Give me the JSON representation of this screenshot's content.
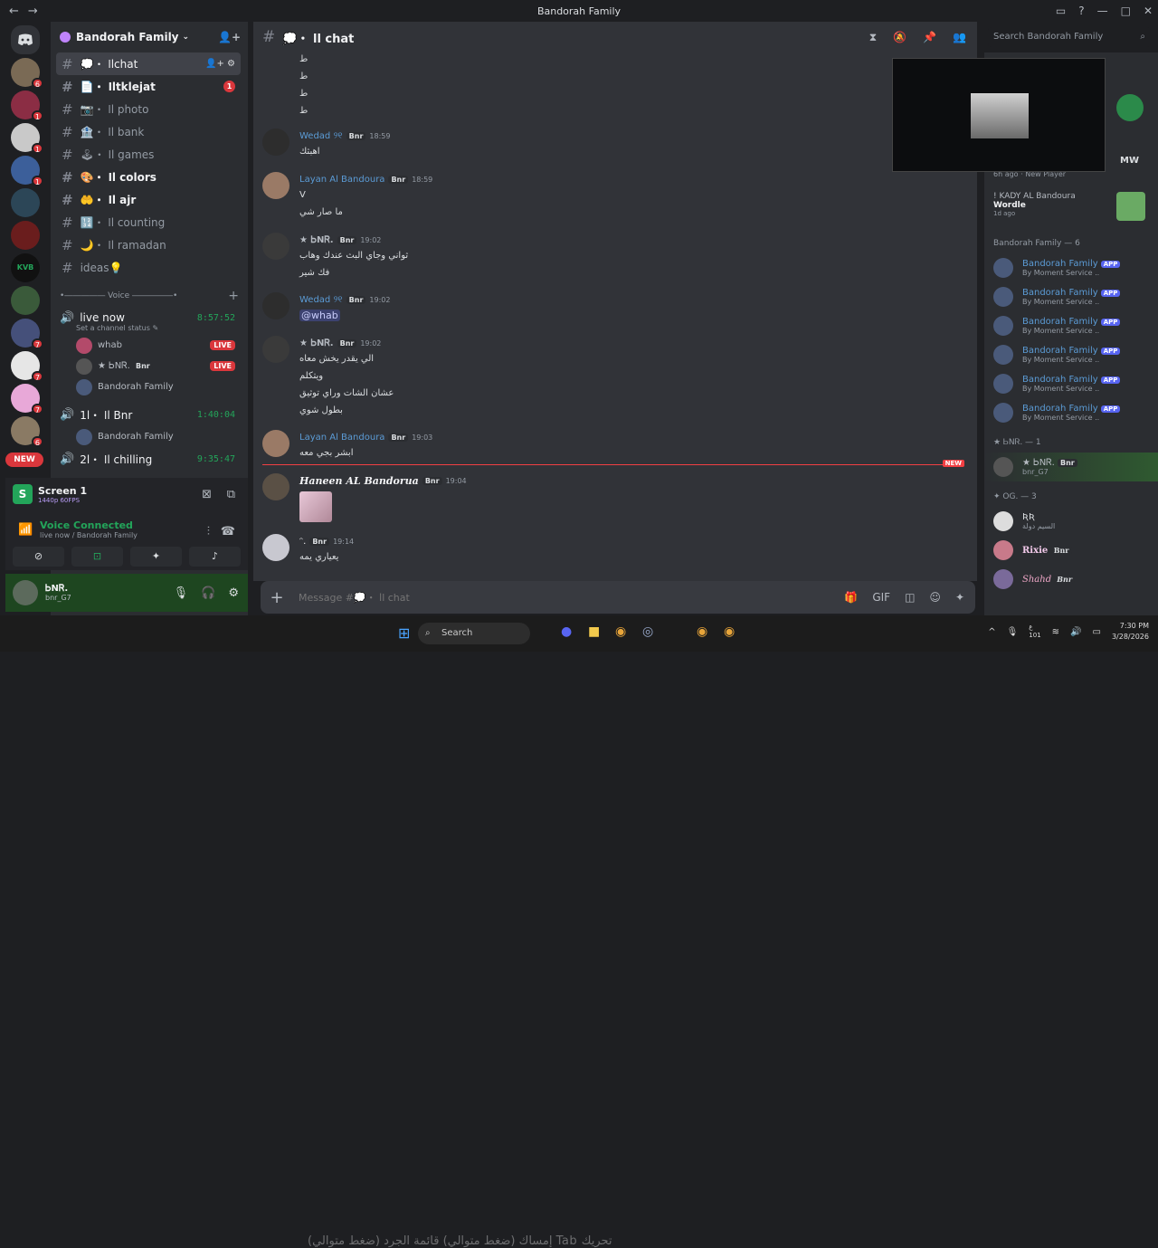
{
  "window": {
    "title": "Bandorah Family"
  },
  "guilds": {
    "badges": [
      "6",
      "1",
      "",
      "1",
      "",
      "1",
      "",
      "",
      "",
      "",
      "",
      "7",
      "",
      "7",
      "",
      "6"
    ],
    "new_label": "NEW"
  },
  "server": {
    "name": "Bandorah Family"
  },
  "channels": [
    {
      "name": "💭・ اlchat",
      "state": "active"
    },
    {
      "name": "📄・ اltklejat",
      "state": "unread",
      "badge": "1"
    },
    {
      "name": "📷・ اl photo",
      "state": "normal"
    },
    {
      "name": "🏦・ اl bank",
      "state": "normal"
    },
    {
      "name": "🕹・ اl games",
      "state": "normal"
    },
    {
      "name": "🎨・ اl colors",
      "state": "unread"
    },
    {
      "name": "🤲・ اl ajr",
      "state": "unread"
    },
    {
      "name": "🔢・ اl counting",
      "state": "normal"
    },
    {
      "name": "🌙・ اl ramadan",
      "state": "normal"
    },
    {
      "name": "ideas💡",
      "state": "normal"
    }
  ],
  "voice_category": {
    "label": "•――――― Voice ―――――•"
  },
  "voice": {
    "live_now": {
      "name": "live now",
      "timer": "8:57:52",
      "status": "Set a channel status ✎",
      "users": [
        {
          "name": "whab",
          "live": "LIVE"
        },
        {
          "name": "★ ᏏNᏒ.",
          "tag": "Bnr",
          "live": "LIVE"
        },
        {
          "name": "Bandorah Family"
        }
      ]
    },
    "bnr": {
      "name": "1l・ اl Bnr",
      "timer": "1:40:04",
      "users": [
        {
          "name": "Bandorah Family"
        }
      ]
    },
    "chilling": {
      "name": "2l・ اl chilling",
      "timer": "9:35:47"
    }
  },
  "screen": {
    "title": "Screen 1",
    "quality": "1440p 60FPS"
  },
  "voice_connected": {
    "title": "Voice Connected",
    "sub": "live now / Bandorah Family"
  },
  "user": {
    "name": "ᏏNᏒ.",
    "tag": "bnr_G7"
  },
  "chat": {
    "channel": "💭・ اl chat",
    "search_placeholder": "Search Bandorah Family",
    "composer_placeholder": "Message #💭・ اl chat"
  },
  "messages": [
    {
      "name": "",
      "lines": [
        "ط",
        "ط",
        "ط",
        "ط"
      ]
    },
    {
      "name": "Wedad ୨୧",
      "tag": "Bnr",
      "time": "18:59",
      "lines": [
        "اهبثك"
      ]
    },
    {
      "name": "Layan Al Bandoura",
      "tag": "Bnr",
      "time": "18:59",
      "lines": [
        "V",
        "ما صار شي"
      ]
    },
    {
      "name": "★ ᏏNᏒ.",
      "tag": "Bnr",
      "time": "19:02",
      "lines": [
        "ثواني وجاي البث عندك وهاب",
        "فك شير"
      ]
    },
    {
      "name": "Wedad ୨୧",
      "tag": "Bnr",
      "time": "19:02",
      "lines": [
        "@whab"
      ]
    },
    {
      "name": "★ ᏏNᏒ.",
      "tag": "Bnr",
      "time": "19:02",
      "lines": [
        "الي يقدر يخش معاه",
        "ويتكلم",
        "عشان الشات وراي توثيق",
        "بطول شوي"
      ]
    },
    {
      "name": "Layan Al Bandoura",
      "tag": "Bnr",
      "time": "19:03",
      "lines": [
        "ابشر بجي معه"
      ]
    },
    {
      "name": "Haneen AL Bandorua",
      "tag": "Bnr",
      "time": "19:04",
      "lines": []
    },
    {
      "name": "ᵔ.",
      "tag": "Bnr",
      "time": "19:14",
      "lines": [
        "يعياري يمه"
      ]
    }
  ],
  "new_label": "NEW",
  "members": {
    "activity1": "6h ago · New Player",
    "activity2_user": "! KADY AL Bandoura",
    "activity2_game": "Wordle",
    "activity2_time": "1d ago",
    "group1": "Bandorah Family — 6",
    "bot_name": "Bandorah Family",
    "bot_badge": "APP",
    "bot_status": "By Moment Service ..",
    "group2": "★ ᏏNᏒ. — 1",
    "m_bnr": "★ ᏏNᏒ.",
    "m_bnr_tag": "bnr_G7",
    "group3": "✦ OG. — 3",
    "m_kr": "ƦƦ",
    "m_kr_sub": "السيم دولة",
    "m_rixie": "Rixie",
    "m_shahd": "Shahd",
    "tag": "Bnr"
  },
  "taskbar": {
    "search": "Search",
    "time": "7:30 PM",
    "date": "3/28/2026",
    "lang": "ع\n101",
    "overlay": "(ضغط متوالي) إمساك    (ضغط متوالي) قائمة الجرد Tab  تحريك"
  },
  "colors": {
    "accent": "#5865f2",
    "green": "#23a55a",
    "red": "#da373c"
  }
}
